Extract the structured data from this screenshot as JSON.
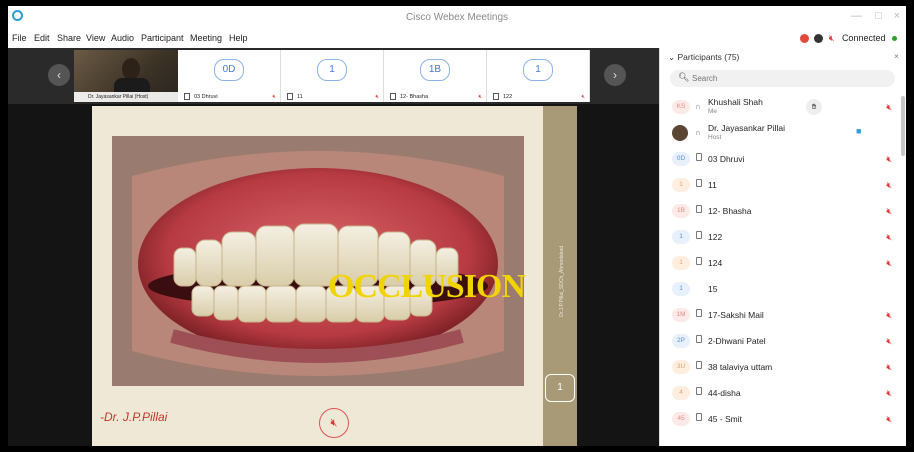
{
  "window": {
    "title": "Cisco Webex Meetings",
    "controls": [
      "—",
      "□",
      "×"
    ]
  },
  "menu": [
    "File",
    "Edit",
    "Share",
    "View",
    "Audio",
    "Participant",
    "Meeting",
    "Help"
  ],
  "status": {
    "label": "Connected"
  },
  "strip": {
    "tiles": [
      {
        "name": "Dr. Jayasankar Pillai (Host)",
        "video": true
      },
      {
        "initials": "0D",
        "name": "03 Dhruvi"
      },
      {
        "initials": "1",
        "name": "11"
      },
      {
        "initials": "1B",
        "name": "12- Bhasha"
      },
      {
        "initials": "1",
        "name": "122"
      }
    ]
  },
  "slide": {
    "overlay_text": "OCCLUSION",
    "author": "-Dr. J.P.Pillai",
    "watermark": "Dr.J.P.Pillai_SDCh_Ahmedabad",
    "page": "1"
  },
  "participants": {
    "header": "Participants (75)",
    "search_placeholder": "Search",
    "list": [
      {
        "initials": "KS",
        "name": "Khushali Shah",
        "role": "Me",
        "style": "red"
      },
      {
        "initials": "",
        "name": "Dr. Jayasankar Pillai",
        "role": "Host",
        "style": "photo"
      },
      {
        "initials": "0D",
        "name": "03 Dhruvi",
        "role": "",
        "style": "blue"
      },
      {
        "initials": "1",
        "name": "11",
        "role": "",
        "style": "peach"
      },
      {
        "initials": "1B",
        "name": "12- Bhasha",
        "role": "",
        "style": "red"
      },
      {
        "initials": "1",
        "name": "122",
        "role": "",
        "style": "blue"
      },
      {
        "initials": "1",
        "name": "124",
        "role": "",
        "style": "peach"
      },
      {
        "initials": "1",
        "name": "15",
        "role": "",
        "style": "blue"
      },
      {
        "initials": "1M",
        "name": "17-Sakshi Mail",
        "role": "",
        "style": "red"
      },
      {
        "initials": "2P",
        "name": "2-Dhwani Patel",
        "role": "",
        "style": "blue"
      },
      {
        "initials": "3U",
        "name": "38 talaviya uttam",
        "role": "",
        "style": "peach"
      },
      {
        "initials": "4",
        "name": "44-disha",
        "role": "",
        "style": "peach"
      },
      {
        "initials": "45",
        "name": "45 - Smit",
        "role": "",
        "style": "red"
      }
    ]
  },
  "colors": {
    "accent": "#2a9fd6",
    "mute_red": "#d33333",
    "occlusion_yellow": "#f2d400",
    "connected_green": "#2ca02c"
  }
}
